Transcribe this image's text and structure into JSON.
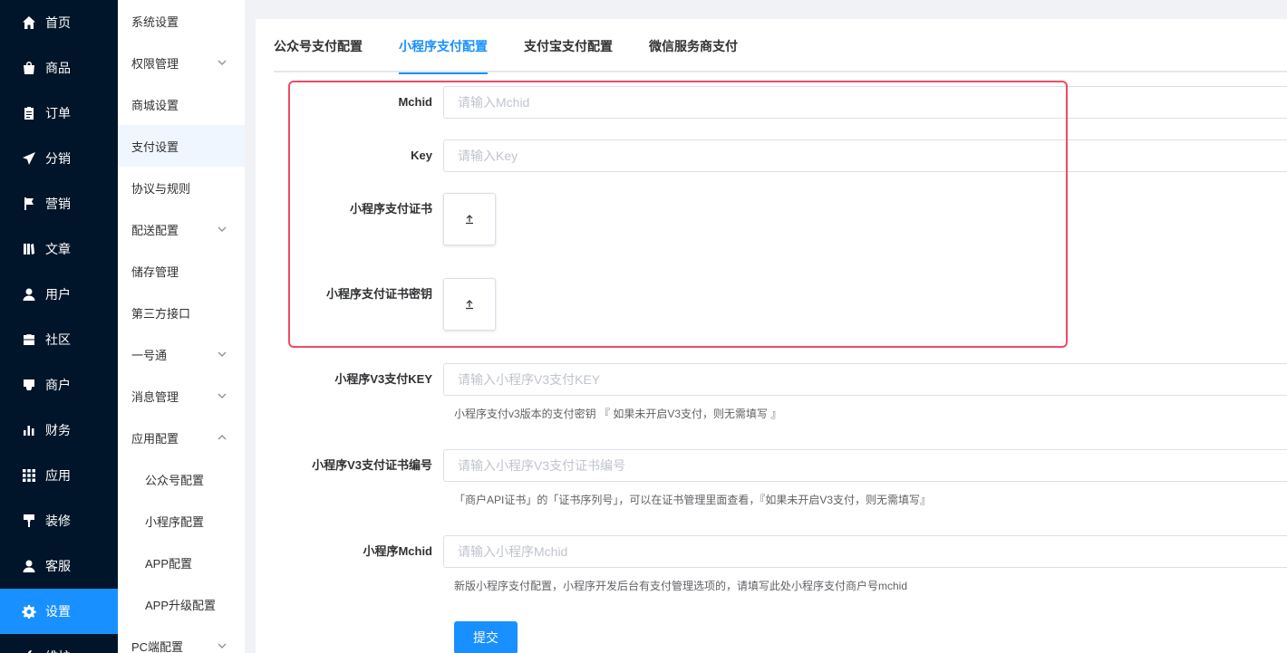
{
  "main_menu": [
    {
      "label": "首页",
      "icon": "home-icon"
    },
    {
      "label": "商品",
      "icon": "shop-bag-icon"
    },
    {
      "label": "订单",
      "icon": "clipboard-icon"
    },
    {
      "label": "分销",
      "icon": "send-icon"
    },
    {
      "label": "营销",
      "icon": "flag-icon"
    },
    {
      "label": "文章",
      "icon": "book-icon"
    },
    {
      "label": "用户",
      "icon": "user-icon"
    },
    {
      "label": "社区",
      "icon": "briefcase-icon"
    },
    {
      "label": "商户",
      "icon": "store-icon"
    },
    {
      "label": "财务",
      "icon": "bar-chart-icon"
    },
    {
      "label": "应用",
      "icon": "grid-icon"
    },
    {
      "label": "装修",
      "icon": "paint-roller-icon"
    },
    {
      "label": "客服",
      "icon": "user-headset-icon"
    },
    {
      "label": "设置",
      "icon": "gear-icon",
      "active": true
    },
    {
      "label": "维护",
      "icon": "tool-icon"
    }
  ],
  "sub_menu": [
    {
      "label": "系统设置"
    },
    {
      "label": "权限管理",
      "chevron": "down"
    },
    {
      "label": "商城设置"
    },
    {
      "label": "支付设置",
      "active": true
    },
    {
      "label": "协议与规则"
    },
    {
      "label": "配送配置",
      "chevron": "down"
    },
    {
      "label": "储存管理"
    },
    {
      "label": "第三方接口"
    },
    {
      "label": "一号通",
      "chevron": "down"
    },
    {
      "label": "消息管理",
      "chevron": "down"
    },
    {
      "label": "应用配置",
      "chevron": "up"
    },
    {
      "label": "公众号配置",
      "child": true
    },
    {
      "label": "小程序配置",
      "child": true
    },
    {
      "label": "APP配置",
      "child": true
    },
    {
      "label": "APP升级配置",
      "child": true
    },
    {
      "label": "PC端配置",
      "chevron": "down"
    }
  ],
  "tabs": [
    "公众号支付配置",
    "小程序支付配置",
    "支付宝支付配置",
    "微信服务商支付"
  ],
  "active_tab": 1,
  "form": {
    "mchid": {
      "label": "Mchid",
      "placeholder": "请输入Mchid"
    },
    "key": {
      "label": "Key",
      "placeholder": "请输入Key"
    },
    "cert": {
      "label": "小程序支付证书"
    },
    "cert_key": {
      "label": "小程序支付证书密钥"
    },
    "v3_key": {
      "label": "小程序V3支付KEY",
      "placeholder": "请输入小程序V3支付KEY",
      "help": "小程序支付v3版本的支付密钥 『 如果未开启V3支付，则无需填写 』"
    },
    "v3_serial": {
      "label": "小程序V3支付证书编号",
      "placeholder": "请输入小程序V3支付证书编号",
      "help": "「商户API证书」的「证书序列号」，可以在证书管理里面查看，『如果未开启V3支付，则无需填写』"
    },
    "mp_mchid": {
      "label": "小程序Mchid",
      "placeholder": "请输入小程序Mchid",
      "help": "新版小程序支付配置，小程序开发后台有支付管理选项的，请填写此处小程序支付商户号mchid"
    },
    "submit_label": "提交"
  },
  "colors": {
    "accent": "#1890ff",
    "sidebar_bg": "#001529",
    "highlight": "#ef4a66"
  }
}
